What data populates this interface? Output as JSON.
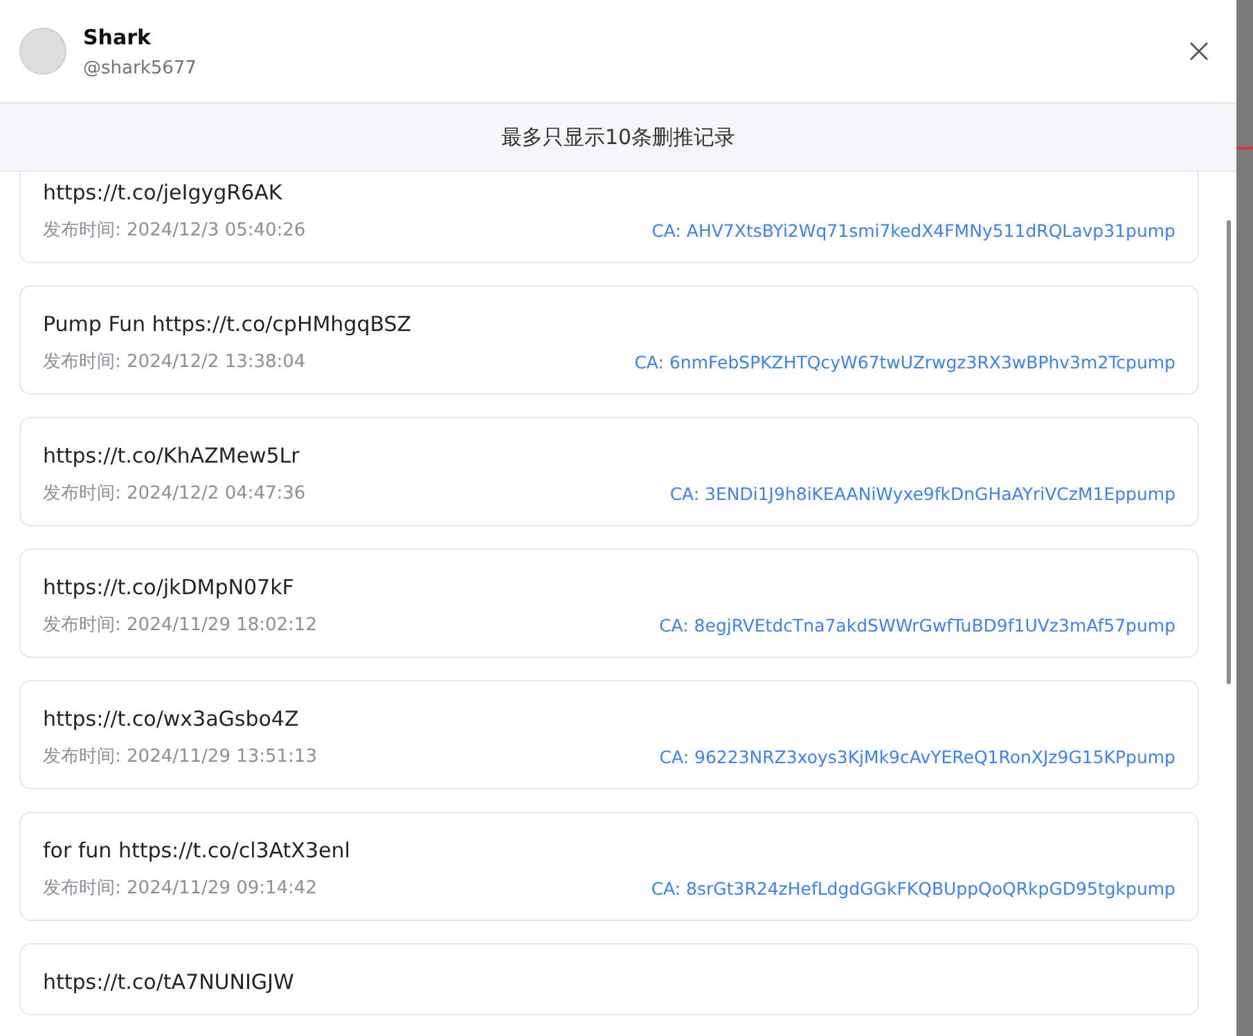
{
  "profile": {
    "name": "Shark",
    "handle": "@shark5677"
  },
  "notice": "最多只显示10条删推记录",
  "records": [
    {
      "text": "https://t.co/jeIgygR6AK",
      "time_label": "发布时间:",
      "time": "2024/12/3 05:40:26",
      "ca": "CA: AHV7XtsBYi2Wq71smi7kedX4FMNy511dRQLavp31pump"
    },
    {
      "text": "Pump Fun https://t.co/cpHMhgqBSZ",
      "time_label": "发布时间:",
      "time": "2024/12/2 13:38:04",
      "ca": "CA: 6nmFebSPKZHTQcyW67twUZrwgz3RX3wBPhv3m2Tcpump"
    },
    {
      "text": "https://t.co/KhAZMew5Lr",
      "time_label": "发布时间:",
      "time": "2024/12/2 04:47:36",
      "ca": "CA: 3ENDi1J9h8iKEAANiWyxe9fkDnGHaAYriVCzM1Eppump"
    },
    {
      "text": "https://t.co/jkDMpN07kF",
      "time_label": "发布时间:",
      "time": "2024/11/29 18:02:12",
      "ca": "CA: 8egjRVEtdcTna7akdSWWrGwfTuBD9f1UVz3mAf57pump"
    },
    {
      "text": "https://t.co/wx3aGsbo4Z",
      "time_label": "发布时间:",
      "time": "2024/11/29 13:51:13",
      "ca": "CA: 96223NRZ3xoys3KjMk9cAvYEReQ1RonXJz9G15KPpump"
    },
    {
      "text": "for fun https://t.co/cl3AtX3enl",
      "time_label": "发布时间:",
      "time": "2024/11/29 09:14:42",
      "ca": "CA: 8srGt3R24zHefLdgdGGkFKQBUppQoQRkpGD95tgkpump"
    },
    {
      "text": "https://t.co/tA7NUNIGJW"
    }
  ]
}
